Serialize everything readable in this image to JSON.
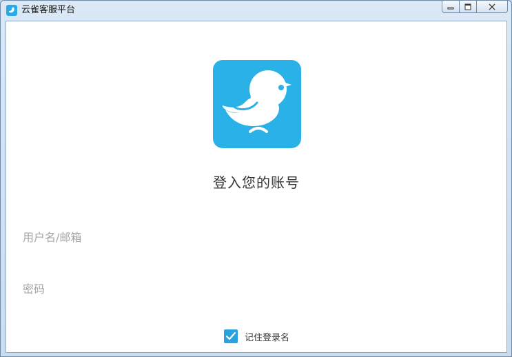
{
  "window": {
    "title": "云雀客服平台",
    "app_icon": "bird-icon",
    "controls": [
      "minimize-icon",
      "maximize-icon",
      "close-icon"
    ]
  },
  "login": {
    "logo_icon": "bird-logo-icon",
    "heading": "登入您的账号",
    "username_placeholder": "用户名/邮箱",
    "password_placeholder": "密码",
    "remember_label": "记住登录名",
    "remember_checked": true
  },
  "colors": {
    "accent": "#29b1e8",
    "checkbox": "#29a3e0",
    "placeholder": "#a5a5a5"
  }
}
